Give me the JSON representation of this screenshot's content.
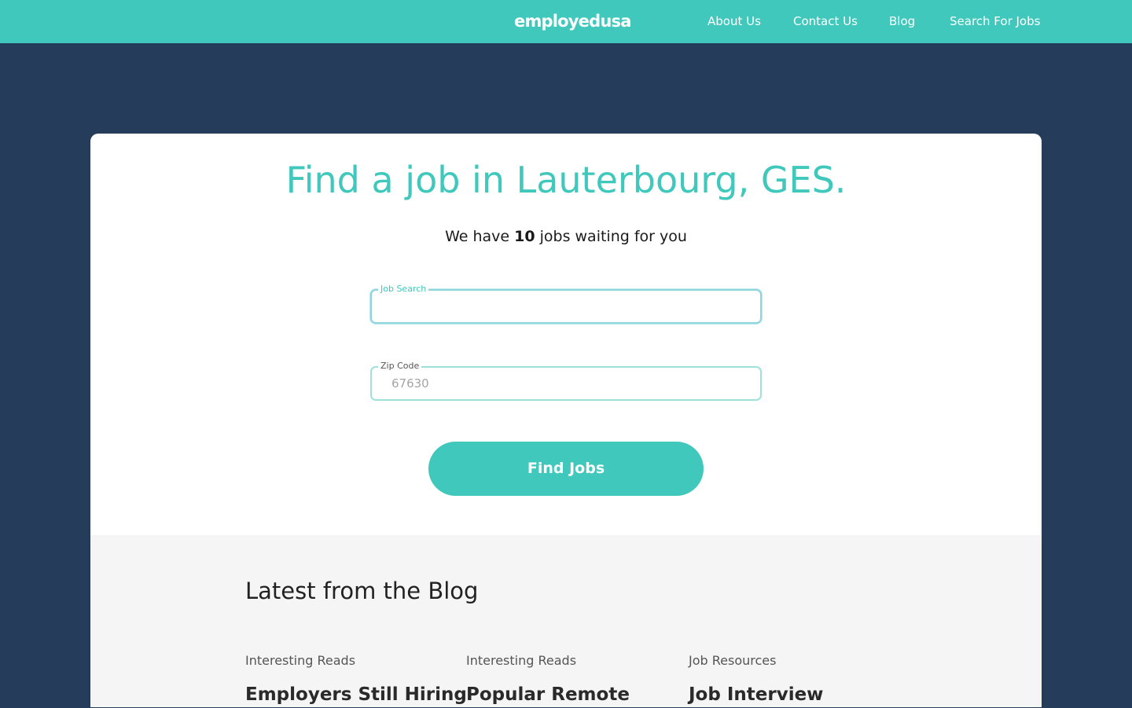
{
  "header": {
    "logo": "employedusa",
    "nav": {
      "about": "About Us",
      "contact": "Contact Us",
      "blog": "Blog",
      "search": "Search For Jobs"
    }
  },
  "hero": {
    "title": "Find a job in Lauterbourg, GES.",
    "subtitle_before": "We have ",
    "job_count": "10",
    "subtitle_after": " jobs waiting for you"
  },
  "form": {
    "job_search": {
      "label": "Job Search",
      "value": "",
      "placeholder": ""
    },
    "zip_code": {
      "label": "Zip Code",
      "value": "",
      "placeholder": "67630"
    },
    "submit_label": "Find Jobs"
  },
  "blog": {
    "heading": "Latest from the Blog",
    "posts": [
      {
        "category": "Interesting Reads",
        "title": "Employers Still Hiring"
      },
      {
        "category": "Interesting Reads",
        "title": "Popular Remote"
      },
      {
        "category": "Job Resources",
        "title": "Job Interview"
      }
    ]
  },
  "colors": {
    "accent": "#3fc8bb",
    "page_background": "#253c5b",
    "blog_background": "#f5f5f5"
  }
}
